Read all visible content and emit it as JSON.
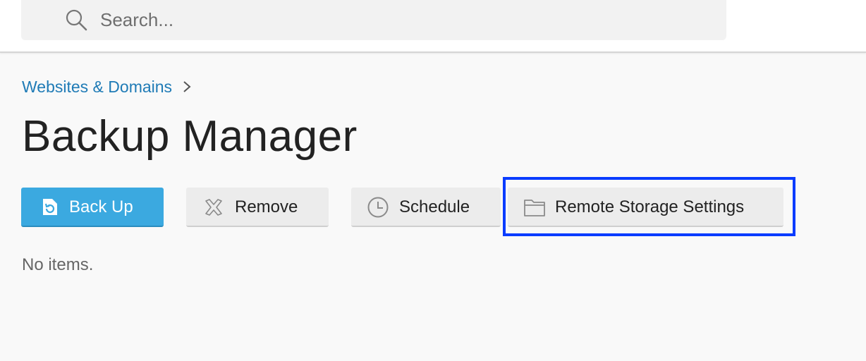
{
  "search": {
    "placeholder": "Search..."
  },
  "breadcrumb": {
    "items": [
      "Websites & Domains"
    ]
  },
  "page": {
    "title": "Backup Manager",
    "empty_text": "No items."
  },
  "toolbar": {
    "backup_label": "Back Up",
    "remove_label": "Remove",
    "schedule_label": "Schedule",
    "remote_storage_label": "Remote Storage Settings"
  },
  "colors": {
    "primary": "#3ba9e0",
    "link": "#1f7bb6",
    "highlight": "#0a3cff"
  },
  "icons": {
    "search": "search-icon",
    "breadcrumb_sep": "chevron-right-icon",
    "backup": "backup-icon",
    "remove": "close-icon",
    "schedule": "clock-icon",
    "remote_storage": "folder-icon"
  }
}
